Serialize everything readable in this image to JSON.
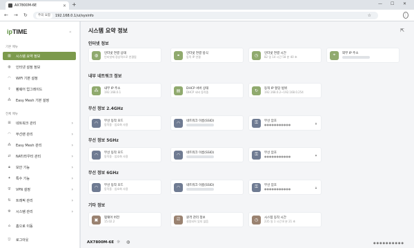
{
  "browser": {
    "tab_title": "AX7800M-6E",
    "security_label": "주의 요함",
    "url": "192.168.0.1/ui/sysinfo"
  },
  "sidebar": {
    "logo_prefix": "ip",
    "logo_suffix": "TIME",
    "basic_menu_title": "기본 메뉴",
    "basic_items": [
      {
        "label": "시스템 요약 정보",
        "icon": "chart-icon",
        "active": true
      },
      {
        "label": "인터넷 설정 정보",
        "icon": "globe-icon"
      },
      {
        "label": "WiFi 기본 설정",
        "icon": "wifi-icon"
      },
      {
        "label": "펌웨어 업그레이드",
        "icon": "upload-icon"
      },
      {
        "label": "Easy Mesh 기본 설정",
        "icon": "mesh-icon"
      }
    ],
    "full_menu_title": "전체 메뉴",
    "full_items": [
      {
        "label": "네트워크 관리",
        "icon": "network-icon"
      },
      {
        "label": "무선랜 관리",
        "icon": "wifi-icon"
      },
      {
        "label": "Easy Mesh 관리",
        "icon": "mesh-icon"
      },
      {
        "label": "NAT/라우터 관리",
        "icon": "router-icon"
      },
      {
        "label": "보안 기능",
        "icon": "lock-icon"
      },
      {
        "label": "특수 기능",
        "icon": "star-icon"
      },
      {
        "label": "VPN 설정",
        "icon": "vpn-icon"
      },
      {
        "label": "트래픽 관리",
        "icon": "traffic-icon"
      },
      {
        "label": "시스템 관리",
        "icon": "gear-icon"
      }
    ],
    "home_label": "홈으로 이동",
    "logout_label": "로그아웃"
  },
  "main": {
    "title": "시스템 요약 정보",
    "sections": {
      "internet": {
        "title": "인터넷 정보",
        "cards": [
          {
            "label": "인터넷 연결 상태",
            "value": "인터넷에 정상적으로 연결됨",
            "icon": "globe-icon"
          },
          {
            "label": "인터넷 연결 방식",
            "value": "동적 IP 연결",
            "icon": "link-icon"
          },
          {
            "label": "인터넷 연결 시간",
            "value": "82 일 14 시간 58 분 40 초",
            "icon": "clock-icon"
          },
          {
            "label": "외부 IP 주소",
            "value": "",
            "icon": "pin-icon"
          }
        ]
      },
      "lan": {
        "title": "내부 네트워크 정보",
        "cards": [
          {
            "label": "내부 IP 주소",
            "value": "192.168.0.1",
            "icon": "network-icon"
          },
          {
            "label": "DHCP 서버 상태",
            "value": "DHCP 서버 동작중",
            "icon": "server-icon"
          },
          {
            "label": "동적 IP 할당 범위",
            "value": "192.168.0.2~192.168.0.254",
            "icon": "range-icon"
          }
        ]
      },
      "w24": {
        "title": "무선 정보 2.4GHz",
        "mode_label": "무선 동작 모드",
        "mode_value": "동작중 · 암호화 사용",
        "ssid_label": "네트워크 이름(SSID)",
        "pw_label": "무선 암호",
        "pw_value": "●●●●●●●●●●●"
      },
      "w5": {
        "title": "무선 정보 5GHz",
        "mode_label": "무선 동작 모드",
        "mode_value": "동작중 · 암호화 사용",
        "ssid_label": "네트워크 이름(SSID)",
        "pw_label": "무선 암호",
        "pw_value": "●●●●●●●●●●●"
      },
      "w6": {
        "title": "무선 정보 6GHz",
        "mode_label": "무선 동작 모드",
        "mode_value": "동작중 · 암호화 사용",
        "ssid_label": "네트워크 이름(SSID)",
        "pw_label": "무선 암호",
        "pw_value": "●●●●●●●●●●●"
      },
      "etc": {
        "title": "기타 정보",
        "cards": [
          {
            "label": "펌웨어 버전",
            "value": "15.02.2",
            "icon": "firmware-icon"
          },
          {
            "label": "원격 관리 정보",
            "value": "설정되어 있지 않음",
            "icon": "remote-icon"
          },
          {
            "label": "시스템 동작 시간",
            "value": "235 일 1 시간 8 분 21 초",
            "icon": "clock-icon"
          }
        ]
      }
    }
  },
  "footer": {
    "model": "AX7800M-6E",
    "separator": "|",
    "dots": "●●●●●●●●●●"
  },
  "colors": {
    "accent_green": "#7c9a4c",
    "icon_green": "#90aa6e",
    "icon_slate": "#6f7b92",
    "icon_brown": "#9a8270"
  }
}
